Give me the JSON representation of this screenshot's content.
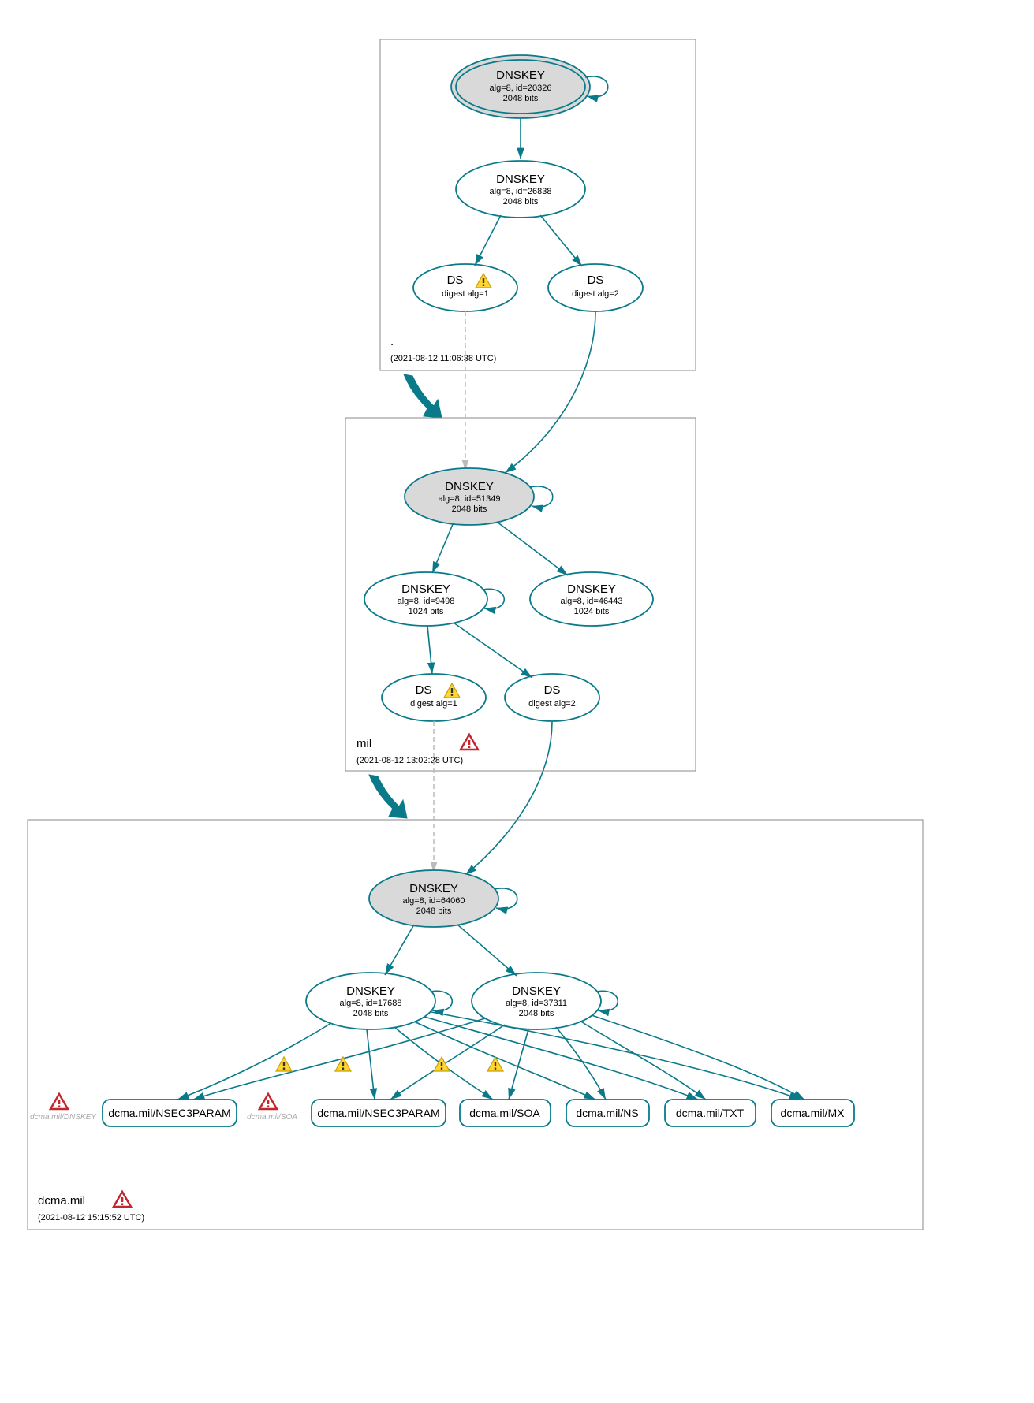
{
  "zones": {
    "root": {
      "label": ".",
      "timestamp": "(2021-08-12 11:06:38 UTC)"
    },
    "mil": {
      "label": "mil",
      "timestamp": "(2021-08-12 13:02:28 UTC)"
    },
    "dcma": {
      "label": "dcma.mil",
      "timestamp": "(2021-08-12 15:15:52 UTC)"
    }
  },
  "nodes": {
    "root_ksk": {
      "title": "DNSKEY",
      "alg": "alg=8, id=20326",
      "bits": "2048 bits"
    },
    "root_zsk": {
      "title": "DNSKEY",
      "alg": "alg=8, id=26838",
      "bits": "2048 bits"
    },
    "root_ds1": {
      "title": "DS",
      "digest": "digest alg=1"
    },
    "root_ds2": {
      "title": "DS",
      "digest": "digest alg=2"
    },
    "mil_ksk": {
      "title": "DNSKEY",
      "alg": "alg=8, id=51349",
      "bits": "2048 bits"
    },
    "mil_zsk1": {
      "title": "DNSKEY",
      "alg": "alg=8, id=9498",
      "bits": "1024 bits"
    },
    "mil_zsk2": {
      "title": "DNSKEY",
      "alg": "alg=8, id=46443",
      "bits": "1024 bits"
    },
    "mil_ds1": {
      "title": "DS",
      "digest": "digest alg=1"
    },
    "mil_ds2": {
      "title": "DS",
      "digest": "digest alg=2"
    },
    "dcma_ksk": {
      "title": "DNSKEY",
      "alg": "alg=8, id=64060",
      "bits": "2048 bits"
    },
    "dcma_zsk1": {
      "title": "DNSKEY",
      "alg": "alg=8, id=17688",
      "bits": "2048 bits"
    },
    "dcma_zsk2": {
      "title": "DNSKEY",
      "alg": "alg=8, id=37311",
      "bits": "2048 bits"
    }
  },
  "ghosts": {
    "dnskey": "dcma.mil/DNSKEY",
    "soa": "dcma.mil/SOA"
  },
  "rrsets": {
    "nsec3a": "dcma.mil/NSEC3PARAM",
    "nsec3b": "dcma.mil/NSEC3PARAM",
    "soa": "dcma.mil/SOA",
    "ns": "dcma.mil/NS",
    "txt": "dcma.mil/TXT",
    "mx": "dcma.mil/MX"
  }
}
